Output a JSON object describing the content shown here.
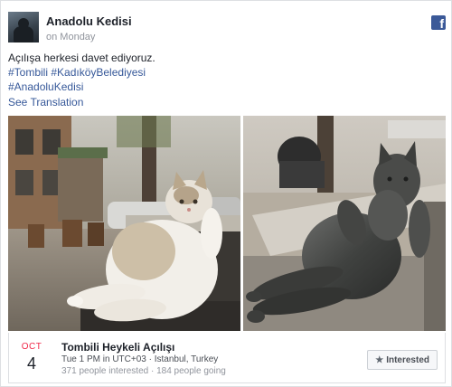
{
  "post": {
    "author": "Anadolu Kedisi",
    "time": "on Monday",
    "message": "Açılışa herkesi davet ediyoruz.",
    "hashtags_line1": "#Tombili #KadıköyBelediyesi",
    "hashtags_line2": "#AnadoluKedisi",
    "see_translation": "See Translation"
  },
  "icons": {
    "brand": "facebook-icon",
    "button": "star-icon"
  },
  "colors": {
    "link": "#365899",
    "month": "#f02849",
    "facebook_brand": "#3b5998"
  },
  "photos": [
    {
      "subject": "cat-photo"
    },
    {
      "subject": "cat-statue-photo"
    }
  ],
  "event": {
    "month": "OCT",
    "day": "4",
    "title": "Tombili Heykeli Açılışı",
    "when_where": "Tue 1 PM in UTC+03 · Istanbul, Turkey",
    "stats": "371 people interested · 184 people going",
    "interested_label": "Interested"
  }
}
